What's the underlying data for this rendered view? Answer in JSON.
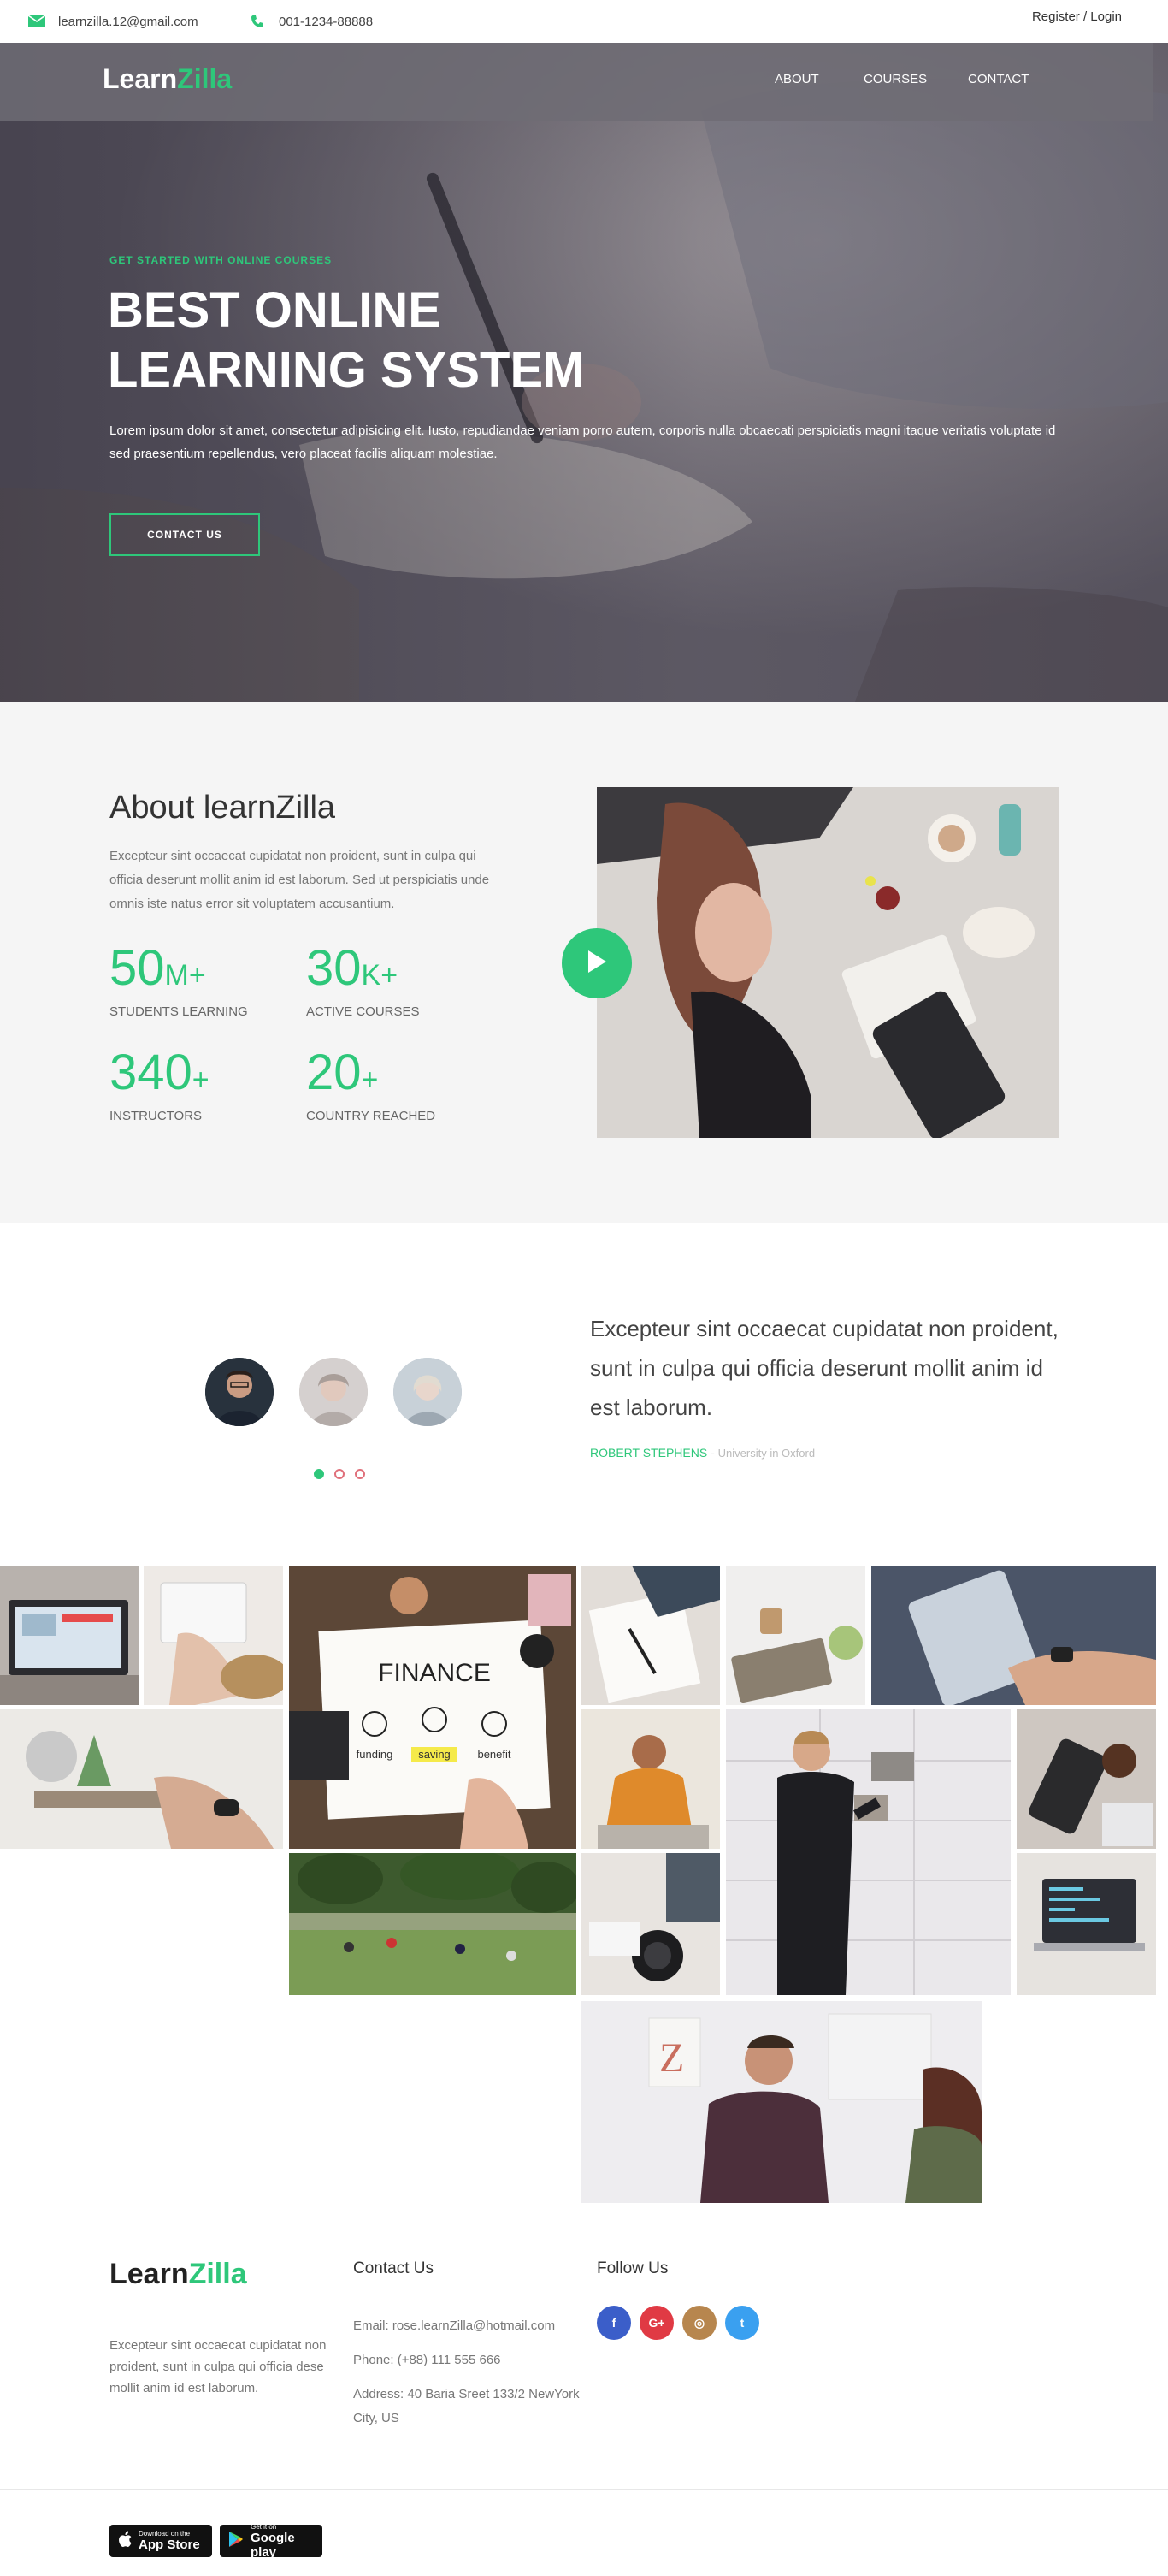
{
  "topbar": {
    "email": "learnzilla.12@gmail.com",
    "phone": "001-1234-88888",
    "login": "Register / Login"
  },
  "brand": {
    "name_part1": "Learn",
    "name_part2": "Zilla",
    "accent_color": "#2ec77a"
  },
  "nav": {
    "about": "ABOUT",
    "courses": "COURSES",
    "contact": "CONTACT"
  },
  "hero": {
    "tagline": "GET STARTED WITH ONLINE COURSES",
    "title_line1": "BEST ONLINE",
    "title_line2": "LEARNING SYSTEM",
    "text": "Lorem ipsum dolor sit amet, consectetur adipisicing elit. Iusto, repudiandae veniam porro autem, corporis nulla obcaecati perspiciatis magni itaque veritatis voluptate id sed praesentium repellendus, vero placeat facilis aliquam molestiae.",
    "button": "CONTACT US"
  },
  "about": {
    "title": "About learnZilla",
    "text": "Excepteur sint occaecat cupidatat non proident, sunt in culpa qui officia deserunt mollit anim id est laborum. Sed ut perspiciatis unde omnis iste natus error sit voluptatem accusantium.",
    "stats": [
      {
        "value": "50",
        "unit": "M+",
        "label": "STUDENTS LEARNING"
      },
      {
        "value": "30",
        "unit": "K+",
        "label": "ACTIVE COURSES"
      },
      {
        "value": "340",
        "unit": "+",
        "label": "INSTRUCTORS"
      },
      {
        "value": "20",
        "unit": "+",
        "label": "COUNTRY REACHED"
      }
    ]
  },
  "testimonial": {
    "quote": "Excepteur sint occaecat cupidatat non proident, sunt in culpa qui officia deserunt mollit anim id est laborum.",
    "author": "ROBERT STEPHENS",
    "separator": " - ",
    "role": "University in Oxford"
  },
  "gallery": {
    "finance_caption": "FINANCE",
    "finance_words": [
      "funding",
      "saving",
      "benefit"
    ]
  },
  "footer": {
    "contact_heading": "Contact Us",
    "follow_heading": "Follow Us",
    "about_text": "Excepteur sint occaecat cupidatat non proident, sunt in culpa qui officia dese mollit anim id est laborum.",
    "email": "Email: rose.learnZilla@hotmail.com",
    "phone": "Phone: (+88) 111 555 666",
    "address": "Address: 40 Baria Sreet 133/2 NewYork City, US",
    "social": {
      "facebook": "f",
      "google": "G+",
      "instagram": "◎",
      "twitter": "t"
    },
    "appstore_small": "Download on the",
    "appstore_big": "App Store",
    "googleplay_small": "Get it on",
    "googleplay_big": "Google play"
  }
}
